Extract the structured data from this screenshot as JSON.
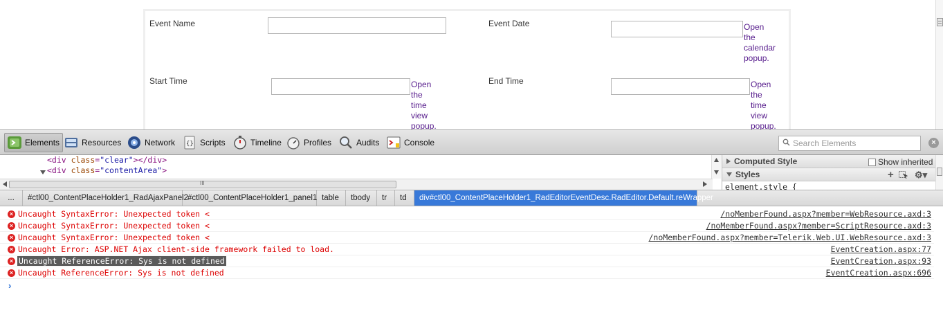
{
  "form": {
    "event_name_label": "Event Name",
    "event_date_label": "Event Date",
    "start_time_label": "Start Time",
    "end_time_label": "End Time",
    "calendar_popup_link": [
      "Open",
      "the",
      "calendar",
      "popup."
    ],
    "time_popup_link": [
      "Open",
      "the",
      "time",
      "view",
      "popup."
    ]
  },
  "toolbar": {
    "tabs": [
      "Elements",
      "Resources",
      "Network",
      "Scripts",
      "Timeline",
      "Profiles",
      "Audits",
      "Console"
    ],
    "active_tab": "Elements",
    "search_placeholder": "Search Elements"
  },
  "elements": {
    "line1": {
      "tag_open": "<div ",
      "attr": "class",
      "eq": "=",
      "value": "\"clear\"",
      "close": "></div>"
    },
    "line2": {
      "tag_open": "<div ",
      "attr": "class",
      "eq": "=",
      "value": "\"contentArea\"",
      "close": ">"
    },
    "scroll_grip": "III"
  },
  "sidebar": {
    "computed_style": "Computed Style",
    "show_inherited": "Show inherited",
    "styles": "Styles",
    "element_style": "element.style {"
  },
  "breadcrumb": [
    "...",
    "#ctl00_ContentPlaceHolder1_RadAjaxPanel2",
    "#ctl00_ContentPlaceHolder1_panel1",
    "table",
    "tbody",
    "tr",
    "td",
    "div#ctl00_ContentPlaceHolder1_RadEditorEventDesc.RadEditor.Default.reWrapper"
  ],
  "console": {
    "messages": [
      {
        "text": "Uncaught SyntaxError: Unexpected token <",
        "source": "/noMemberFound.aspx?member=WebResource.axd:3"
      },
      {
        "text": "Uncaught SyntaxError: Unexpected token <",
        "source": "/noMemberFound.aspx?member=ScriptResource.axd:3"
      },
      {
        "text": "Uncaught SyntaxError: Unexpected token <",
        "source": "/noMemberFound.aspx?member=Telerik.Web.UI.WebResource.axd:3"
      },
      {
        "text": "Uncaught Error: ASP.NET Ajax client-side framework failed to load.",
        "source": "EventCreation.aspx:77"
      },
      {
        "text": "Uncaught ReferenceError: Sys is not defined",
        "source": "EventCreation.aspx:93"
      },
      {
        "text": "Uncaught ReferenceError: Sys is not defined",
        "source": "EventCreation.aspx:696"
      }
    ],
    "prompt": "›"
  }
}
